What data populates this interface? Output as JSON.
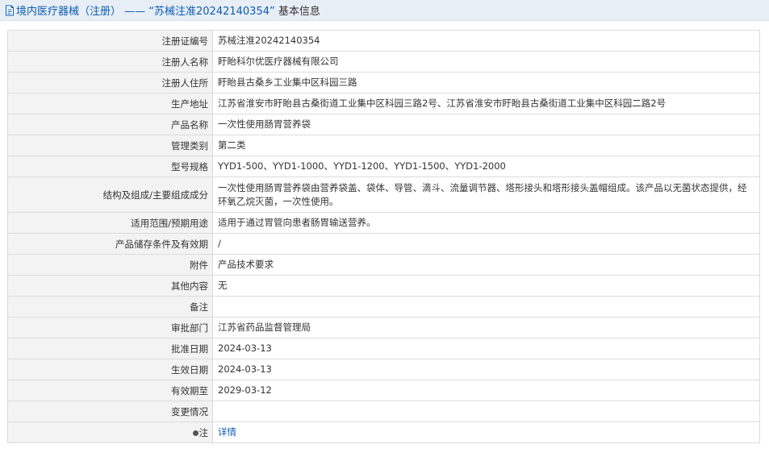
{
  "header": {
    "category": "境内医疗器械（注册）",
    "separator": " —— ",
    "record_name": "“苏械注准20242140354”",
    "suffix": " 基本信息"
  },
  "rows": [
    {
      "label": "注册证编号",
      "value": "苏械注准20242140354"
    },
    {
      "label": "注册人名称",
      "value": "盱眙科尔优医疗器械有限公司"
    },
    {
      "label": "注册人住所",
      "value": "盱眙县古桑乡工业集中区科园三路"
    },
    {
      "label": "生产地址",
      "value": "江苏省淮安市盱眙县古桑街道工业集中区科园三路2号、江苏省淮安市盱眙县古桑街道工业集中区科园二路2号"
    },
    {
      "label": "产品名称",
      "value": "一次性使用肠胃营养袋"
    },
    {
      "label": "管理类别",
      "value": "第二类"
    },
    {
      "label": "型号规格",
      "value": "YYD1-500、YYD1-1000、YYD1-1200、YYD1-1500、YYD1-2000"
    },
    {
      "label": "结构及组成/主要组成成分",
      "value": "一次性使用肠胃营养袋由营养袋盖、袋体、导管、滴斗、流量调节器、塔形接头和塔形接头盖帽组成。该产品以无菌状态提供，经环氧乙烷灭菌，一次性使用。"
    },
    {
      "label": "适用范围/预期用途",
      "value": "适用于通过胃管向患者肠胃输送营养。"
    },
    {
      "label": "产品储存条件及有效期",
      "value": "/"
    },
    {
      "label": "附件",
      "value": "产品技术要求"
    },
    {
      "label": "其他内容",
      "value": "无"
    },
    {
      "label": "备注",
      "value": ""
    },
    {
      "label": "审批部门",
      "value": "江苏省药品监督管理局"
    },
    {
      "label": "批准日期",
      "value": "2024-03-13"
    },
    {
      "label": "生效日期",
      "value": "2024-03-13"
    },
    {
      "label": "有效期至",
      "value": "2029-03-12"
    },
    {
      "label": "变更情况",
      "value": ""
    }
  ],
  "note_row": {
    "label": "注",
    "link_text": "详情",
    "icon": "bullet-icon"
  },
  "colors": {
    "link": "#0a5bb5",
    "label_bg": "#f3f3f3",
    "title_bg": "#e8eef5"
  }
}
